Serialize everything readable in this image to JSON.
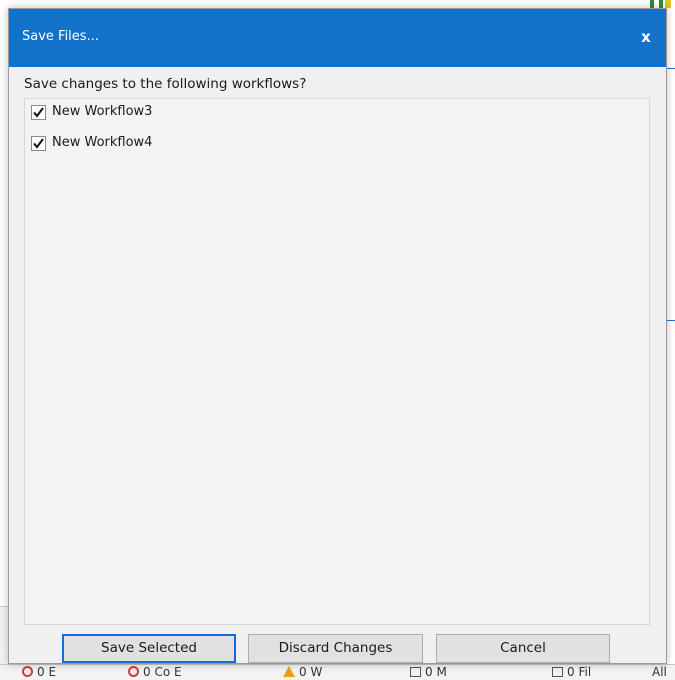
{
  "dialog": {
    "title": "Save Files...",
    "close_label": "x",
    "prompt": "Save changes to the following workflows?",
    "items": [
      {
        "label": "New Workflow3",
        "checked": true
      },
      {
        "label": "New Workflow4",
        "checked": true
      }
    ],
    "buttons": {
      "save_selected": "Save Selected",
      "discard_changes": "Discard Changes",
      "cancel": "Cancel"
    }
  },
  "background": {
    "status_bar": {
      "errors": "0 E",
      "code_errors": "0 Co E",
      "warnings": "0 W",
      "messages": "0 M",
      "files": "0 Fil",
      "all": "All"
    }
  },
  "colors": {
    "titlebar": "#1272c9",
    "primary_border": "#1b6ad0"
  }
}
